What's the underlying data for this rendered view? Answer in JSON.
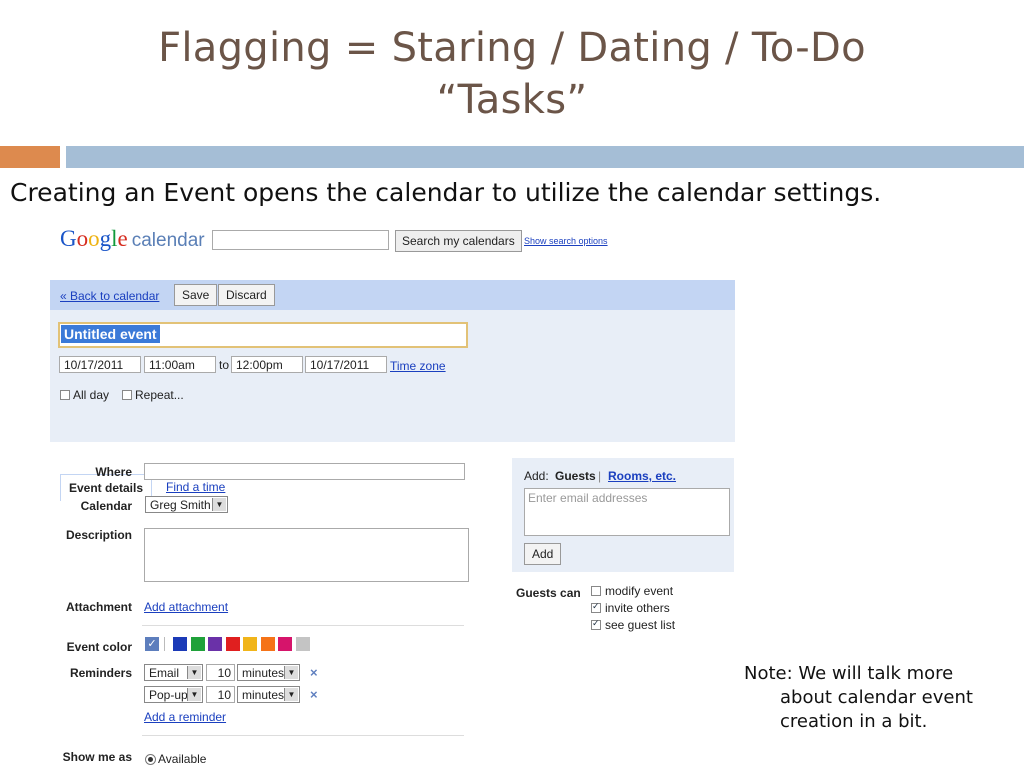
{
  "slide": {
    "title_line1": "Flagging = Staring / Dating / To-Do",
    "title_line2": "“Tasks”",
    "subtitle": "Creating an Event opens the calendar to utilize the calendar settings.",
    "note_line1": "Note: We will talk more",
    "note_line2": "about calendar event",
    "note_line3": "creation in a bit."
  },
  "gcal": {
    "logo_letters": [
      "G",
      "o",
      "o",
      "g",
      "l",
      "e"
    ],
    "logo_suffix": "calendar",
    "search_value": "",
    "search_button": "Search my calendars",
    "search_options_link": "Show search options",
    "back_link": "« Back to calendar",
    "save_button": "Save",
    "discard_button": "Discard",
    "event_title": "Untitled event",
    "start_date": "10/17/2011",
    "start_time": "11:00am",
    "to_label": "to",
    "end_time": "12:00pm",
    "end_date": "10/17/2011",
    "time_zone_link": "Time zone",
    "all_day_label": "All day",
    "repeat_label": "Repeat...",
    "tabs": [
      "Event details",
      "Find a time"
    ],
    "where_label": "Where",
    "where_value": "",
    "calendar_label": "Calendar",
    "calendar_value": "Greg Smith",
    "description_label": "Description",
    "attachment_label": "Attachment",
    "add_attachment_link": "Add attachment",
    "event_color_label": "Event color",
    "event_colors": [
      "#1b3ab7",
      "#1fa13a",
      "#6a31a8",
      "#e01f1f",
      "#f1b51a",
      "#f57318",
      "#d6146b",
      "#c4c4c4"
    ],
    "reminders_label": "Reminders",
    "reminders": [
      {
        "method": "Email",
        "amount": "10",
        "unit": "minutes"
      },
      {
        "method": "Pop-up",
        "amount": "10",
        "unit": "minutes"
      }
    ],
    "add_reminder_link": "Add a reminder",
    "show_me_as_label": "Show me as",
    "show_me_as_value": "Available",
    "guests": {
      "add_prefix": "Add:",
      "guests_tab": "Guests",
      "separator": "|",
      "rooms_link": "Rooms, etc.",
      "email_placeholder": "Enter email addresses",
      "add_button": "Add",
      "guests_can_label": "Guests can",
      "permissions": [
        {
          "label": "modify event",
          "checked": false
        },
        {
          "label": "invite others",
          "checked": true
        },
        {
          "label": "see guest list",
          "checked": true
        }
      ]
    }
  }
}
